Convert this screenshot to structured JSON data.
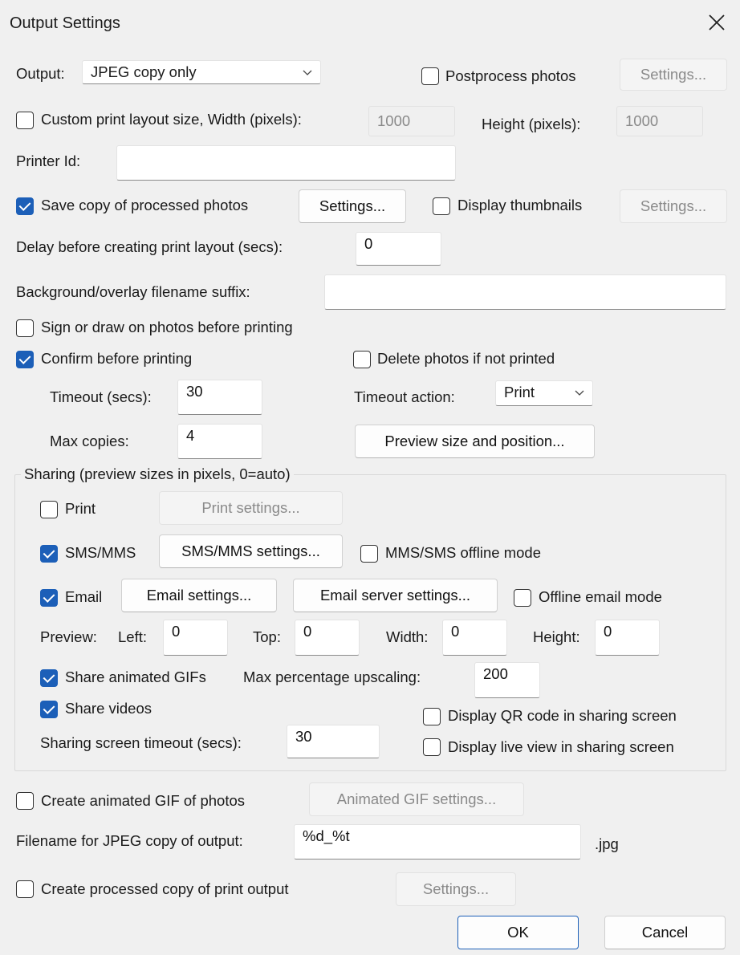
{
  "window": {
    "title": "Output Settings",
    "close_icon": "close-icon"
  },
  "output": {
    "label": "Output:",
    "selected": "JPEG copy only"
  },
  "postprocess": {
    "label": "Postprocess photos",
    "checked": false,
    "settings_label": "Settings..."
  },
  "custom_layout": {
    "label": "Custom print layout size, Width (pixels):",
    "checked": false,
    "width_value": "1000",
    "height_label": "Height (pixels):",
    "height_value": "1000"
  },
  "printer_id": {
    "label": "Printer Id:",
    "value": ""
  },
  "save_copy": {
    "label": "Save copy of processed photos",
    "checked": true,
    "settings_label": "Settings..."
  },
  "display_thumbnails": {
    "label": "Display thumbnails",
    "checked": false,
    "settings_label": "Settings..."
  },
  "delay": {
    "label": "Delay before creating print layout (secs):",
    "value": "0"
  },
  "suffix": {
    "label": "Background/overlay filename suffix:",
    "value": ""
  },
  "sign_draw": {
    "label": "Sign or draw on photos before printing",
    "checked": false
  },
  "confirm": {
    "label": "Confirm before printing",
    "checked": true
  },
  "delete_not_printed": {
    "label": "Delete photos if not printed",
    "checked": false
  },
  "timeout": {
    "label": "Timeout (secs):",
    "value": "30",
    "action_label": "Timeout action:",
    "action_selected": "Print"
  },
  "max_copies": {
    "label": "Max copies:",
    "value": "4"
  },
  "preview_position_button": "Preview size and position...",
  "sharing": {
    "title": "Sharing (preview sizes in pixels, 0=auto)",
    "print": {
      "label": "Print",
      "checked": false,
      "settings_label": "Print settings..."
    },
    "sms": {
      "label": "SMS/MMS",
      "checked": true,
      "settings_label": "SMS/MMS settings...",
      "offline_label": "MMS/SMS offline mode",
      "offline_checked": false
    },
    "email": {
      "label": "Email",
      "checked": true,
      "settings_label": "Email settings...",
      "server_label": "Email server settings...",
      "offline_label": "Offline email mode",
      "offline_checked": false
    },
    "preview": {
      "label": "Preview:",
      "left_label": "Left:",
      "left_value": "0",
      "top_label": "Top:",
      "top_value": "0",
      "width_label": "Width:",
      "width_value": "0",
      "height_label": "Height:",
      "height_value": "0"
    },
    "gifs": {
      "label": "Share animated GIFs",
      "checked": true,
      "upscale_label": "Max percentage upscaling:",
      "upscale_value": "200"
    },
    "videos": {
      "label": "Share videos",
      "checked": true
    },
    "qr": {
      "label": "Display QR code in sharing screen",
      "checked": false
    },
    "screen_timeout": {
      "label": "Sharing screen timeout (secs):",
      "value": "30"
    },
    "live_view": {
      "label": "Display live view in sharing screen",
      "checked": false
    }
  },
  "animated_gif": {
    "label": "Create animated GIF of photos",
    "checked": false,
    "settings_label": "Animated GIF settings..."
  },
  "filename": {
    "label": "Filename for JPEG copy of output:",
    "value": "%d_%t",
    "suffix": ".jpg"
  },
  "processed_copy": {
    "label": "Create processed copy of print output",
    "checked": false,
    "settings_label": "Settings..."
  },
  "buttons": {
    "ok": "OK",
    "cancel": "Cancel"
  },
  "colors": {
    "accent": "#1c5fb8",
    "background": "#f0f0f0"
  }
}
